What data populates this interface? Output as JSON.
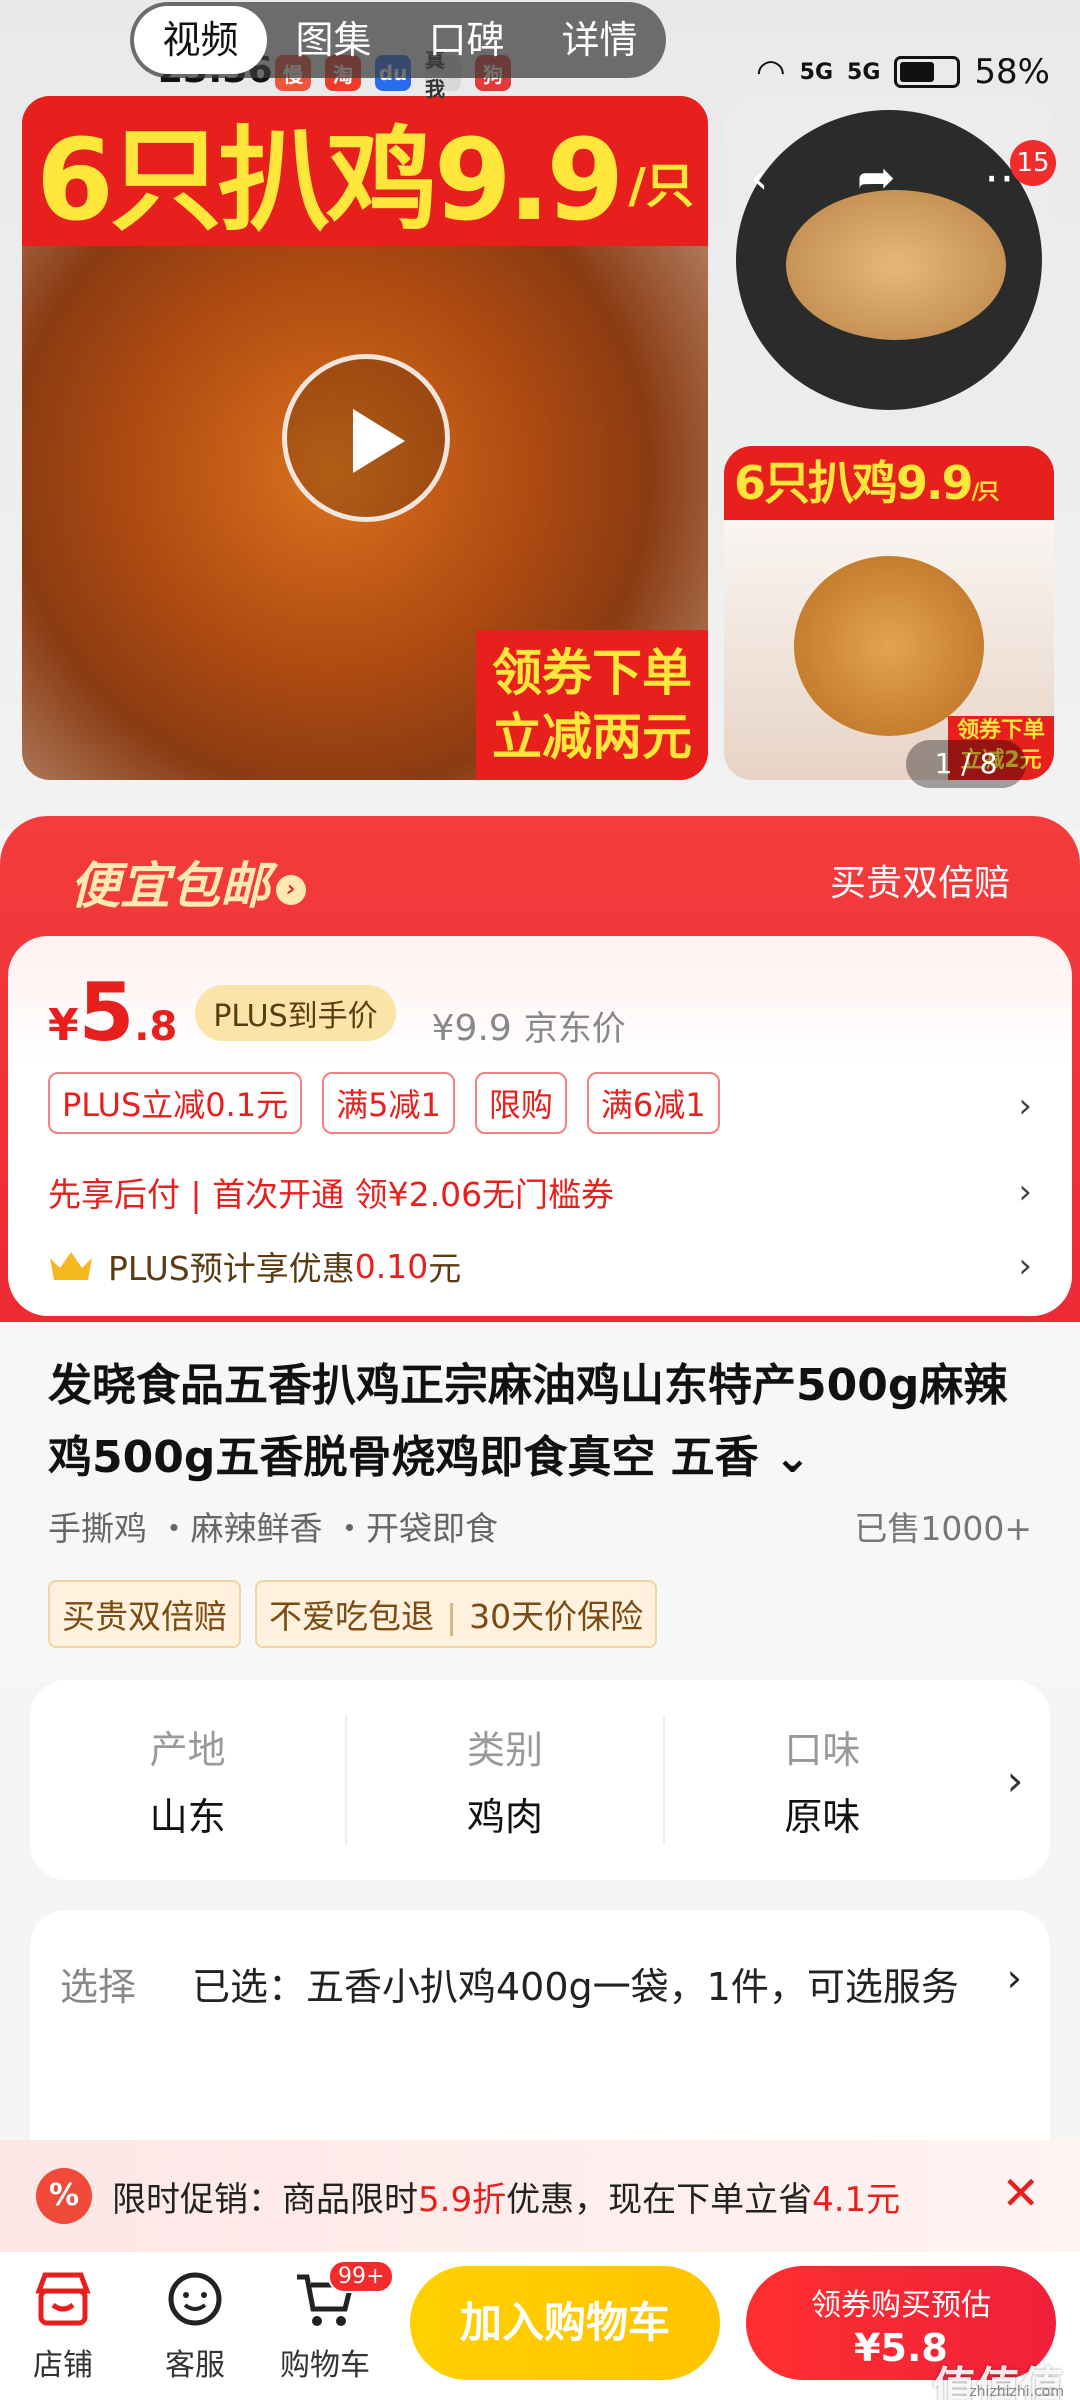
{
  "status_bar": {
    "time": "23:36",
    "battery": "58%",
    "signal1": "5G",
    "signal2": "5G",
    "apps": [
      {
        "text": "慢",
        "color": "#f0543a"
      },
      {
        "text": "淘",
        "color": "#f03a2a"
      },
      {
        "text": "du",
        "color": "#2a6cf0"
      },
      {
        "text": "真我",
        "color": "#d8d8d8"
      },
      {
        "text": "狗",
        "color": "#e53935"
      }
    ]
  },
  "top_tabs": [
    "视频",
    "图集",
    "口碑",
    "详情"
  ],
  "gallery": {
    "banner_text": "6只扒鸡9.9",
    "banner_unit": "/只",
    "coupon_line1": "领券下单",
    "coupon_line2": "立减两元",
    "side_banner": "6只扒鸡9.9",
    "side_banner_unit": "/只",
    "side_coupon_line1": "领券下单",
    "side_coupon_line2": "立减2元",
    "image_badge": "15",
    "pager": "1 / 8"
  },
  "promo_header": {
    "title": "便宜包邮",
    "right": "买贵双倍赔"
  },
  "price": {
    "symbol": "¥",
    "integer": "5",
    "decimal": ".8",
    "plus_tag": "PLUS到手价",
    "original": "¥9.9",
    "original_label": "京东价",
    "tags": [
      "PLUS立减0.1元",
      "满5减1",
      "限购",
      "满6减1"
    ],
    "credit_line": "先享后付 | 首次开通 领¥2.06无门槛券",
    "plus_saving_prefix": "PLUS预计享优惠",
    "plus_saving_value": "0.10",
    "plus_saving_suffix": "元"
  },
  "product": {
    "title": "发晓食品五香扒鸡正宗麻油鸡山东特产500g麻辣鸡500g五香脱骨烧鸡即食真空 五香",
    "features": "手撕鸡 ・麻辣鲜香 ・开袋即食",
    "sold": "已售1000+",
    "services": [
      "买贵双倍赔",
      "不爱吃包退",
      "30天价保险"
    ]
  },
  "attributes": [
    {
      "label": "产地",
      "value": "山东"
    },
    {
      "label": "类别",
      "value": "鸡肉"
    },
    {
      "label": "口味",
      "value": "原味"
    }
  ],
  "selection": {
    "label": "选择",
    "value": "已选：五香小扒鸡400g一袋，1件，可选服务"
  },
  "promo_bar": {
    "icon": "%",
    "prefix": "限时促销：商品限时",
    "discount": "5.9折",
    "middle": "优惠，现在下单立省",
    "saving": "4.1元"
  },
  "bottom_nav": {
    "store": "店铺",
    "service": "客服",
    "cart": "购物车",
    "cart_badge": "99+",
    "add_to_cart": "加入购物车",
    "buy_line1": "领券购买预估",
    "buy_line2": "¥5.8"
  },
  "watermark": {
    "main": "值值值",
    "sub": "zhizhizhi.com"
  },
  "colors": {
    "accent_red": "#e8201d",
    "gold": "#ffe63a",
    "cart_yellow": "#ffc400"
  }
}
